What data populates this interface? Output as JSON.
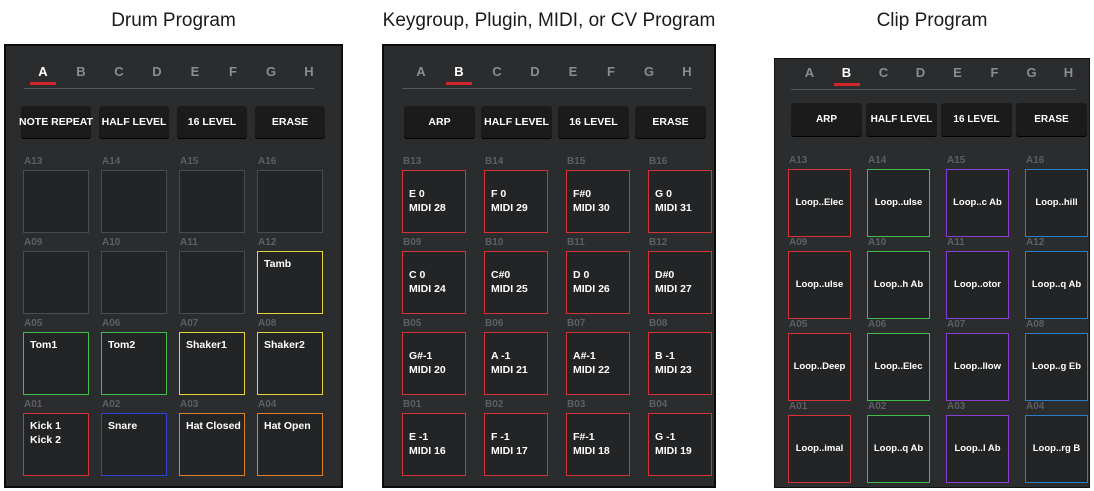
{
  "colors": {
    "red": "#d4333a",
    "green": "#3fbf4a",
    "yellow": "#e4d43a",
    "blue": "#2c43d6",
    "orange": "#e0802c",
    "purple": "#8a3fcf",
    "sky": "#2a7fc9",
    "empty": "#4a4b4d"
  },
  "panels": [
    {
      "caption": "Drum Program",
      "banks": [
        "A",
        "B",
        "C",
        "D",
        "E",
        "F",
        "G",
        "H"
      ],
      "active_bank": "A",
      "buttons": [
        "NOTE REPEAT",
        "HALF LEVEL",
        "16 LEVEL",
        "ERASE"
      ],
      "pads": [
        {
          "id": "A13",
          "line1": "",
          "line2": "",
          "color": "empty"
        },
        {
          "id": "A14",
          "line1": "",
          "line2": "",
          "color": "empty"
        },
        {
          "id": "A15",
          "line1": "",
          "line2": "",
          "color": "empty"
        },
        {
          "id": "A16",
          "line1": "",
          "line2": "",
          "color": "empty"
        },
        {
          "id": "A09",
          "line1": "",
          "line2": "",
          "color": "empty"
        },
        {
          "id": "A10",
          "line1": "",
          "line2": "",
          "color": "empty"
        },
        {
          "id": "A11",
          "line1": "",
          "line2": "",
          "color": "empty"
        },
        {
          "id": "A12",
          "line1": "Tamb",
          "line2": "",
          "color": "yellow"
        },
        {
          "id": "A05",
          "line1": "Tom1",
          "line2": "",
          "color": "green"
        },
        {
          "id": "A06",
          "line1": "Tom2",
          "line2": "",
          "color": "green"
        },
        {
          "id": "A07",
          "line1": "Shaker1",
          "line2": "",
          "color": "yellow"
        },
        {
          "id": "A08",
          "line1": "Shaker2",
          "line2": "",
          "color": "yellow"
        },
        {
          "id": "A01",
          "line1": "Kick 1",
          "line2": "Kick 2",
          "color": "red"
        },
        {
          "id": "A02",
          "line1": "Snare",
          "line2": "",
          "color": "blue"
        },
        {
          "id": "A03",
          "line1": "Hat Closed",
          "line2": "",
          "color": "orange"
        },
        {
          "id": "A04",
          "line1": "Hat Open",
          "line2": "",
          "color": "orange"
        }
      ]
    },
    {
      "caption": "Keygroup, Plugin, MIDI, or CV Program",
      "banks": [
        "A",
        "B",
        "C",
        "D",
        "E",
        "F",
        "G",
        "H"
      ],
      "active_bank": "B",
      "buttons": [
        "ARP",
        "HALF LEVEL",
        "16 LEVEL",
        "ERASE"
      ],
      "pads": [
        {
          "id": "B13",
          "line1": "E 0",
          "line2": "MIDI 28",
          "color": "red"
        },
        {
          "id": "B14",
          "line1": "F 0",
          "line2": "MIDI 29",
          "color": "red"
        },
        {
          "id": "B15",
          "line1": "F#0",
          "line2": "MIDI 30",
          "color": "red"
        },
        {
          "id": "B16",
          "line1": "G 0",
          "line2": "MIDI 31",
          "color": "red"
        },
        {
          "id": "B09",
          "line1": "C 0",
          "line2": "MIDI 24",
          "color": "red"
        },
        {
          "id": "B10",
          "line1": "C#0",
          "line2": "MIDI 25",
          "color": "red"
        },
        {
          "id": "B11",
          "line1": "D 0",
          "line2": "MIDI 26",
          "color": "red"
        },
        {
          "id": "B12",
          "line1": "D#0",
          "line2": "MIDI 27",
          "color": "red"
        },
        {
          "id": "B05",
          "line1": "G#-1",
          "line2": "MIDI 20",
          "color": "red"
        },
        {
          "id": "B06",
          "line1": "A -1",
          "line2": "MIDI 21",
          "color": "red"
        },
        {
          "id": "B07",
          "line1": "A#-1",
          "line2": "MIDI 22",
          "color": "red"
        },
        {
          "id": "B08",
          "line1": "B -1",
          "line2": "MIDI 23",
          "color": "red"
        },
        {
          "id": "B01",
          "line1": "E -1",
          "line2": "MIDI 16",
          "color": "red"
        },
        {
          "id": "B02",
          "line1": "F -1",
          "line2": "MIDI 17",
          "color": "red"
        },
        {
          "id": "B03",
          "line1": "F#-1",
          "line2": "MIDI 18",
          "color": "red"
        },
        {
          "id": "B04",
          "line1": "G -1",
          "line2": "MIDI 19",
          "color": "red"
        }
      ]
    },
    {
      "caption": "Clip Program",
      "banks": [
        "A",
        "B",
        "C",
        "D",
        "E",
        "F",
        "G",
        "H"
      ],
      "active_bank": "B",
      "buttons": [
        "ARP",
        "HALF LEVEL",
        "16 LEVEL",
        "ERASE"
      ],
      "pads": [
        {
          "id": "A13",
          "line1": "Loop..Elec",
          "line2": "",
          "color": "red"
        },
        {
          "id": "A14",
          "line1": "Loop..ulse",
          "line2": "",
          "color": "green"
        },
        {
          "id": "A15",
          "line1": "Loop..c Ab",
          "line2": "",
          "color": "purple"
        },
        {
          "id": "A16",
          "line1": "Loop..hill",
          "line2": "",
          "color": "sky"
        },
        {
          "id": "A09",
          "line1": "Loop..ulse",
          "line2": "",
          "color": "red"
        },
        {
          "id": "A10",
          "line1": "Loop..h Ab",
          "line2": "",
          "color": "green"
        },
        {
          "id": "A11",
          "line1": "Loop..otor",
          "line2": "",
          "color": "purple"
        },
        {
          "id": "A12",
          "line1": "Loop..q Ab",
          "line2": "",
          "color": "sky"
        },
        {
          "id": "A05",
          "line1": "Loop..Deep",
          "line2": "",
          "color": "red"
        },
        {
          "id": "A06",
          "line1": "Loop..Elec",
          "line2": "",
          "color": "green"
        },
        {
          "id": "A07",
          "line1": "Loop..llow",
          "line2": "",
          "color": "purple"
        },
        {
          "id": "A08",
          "line1": "Loop..g Eb",
          "line2": "",
          "color": "sky"
        },
        {
          "id": "A01",
          "line1": "Loop..imal",
          "line2": "",
          "color": "red"
        },
        {
          "id": "A02",
          "line1": "Loop..q Ab",
          "line2": "",
          "color": "green"
        },
        {
          "id": "A03",
          "line1": "Loop..l Ab",
          "line2": "",
          "color": "purple"
        },
        {
          "id": "A04",
          "line1": "Loop..rg B",
          "line2": "",
          "color": "sky"
        }
      ]
    }
  ]
}
